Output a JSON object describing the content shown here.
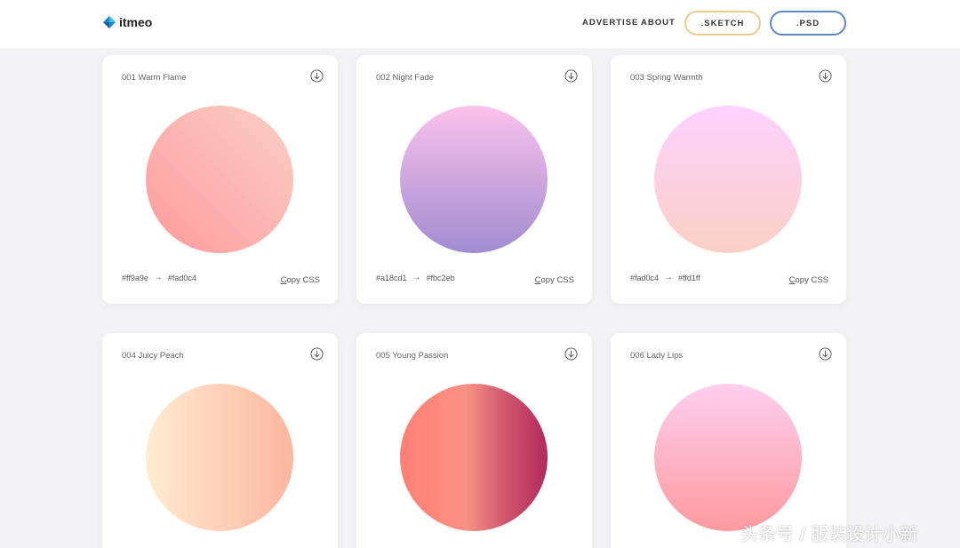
{
  "header": {
    "logo_text": "itmeo",
    "nav": {
      "advertise": "ADVERTISE",
      "about": "ABOUT"
    },
    "buttons": {
      "sketch": ".SKETCH",
      "psd": ".PSD"
    },
    "colors": {
      "sketch_border": "#e6cf8e",
      "psd_border": "#5f86c8"
    }
  },
  "gradients": [
    {
      "title": "001 Warm Flame",
      "from": "#ff9a9e",
      "to": "#fad0c4",
      "copy_prefix": "C",
      "copy_rest": "opy CSS"
    },
    {
      "title": "002 Night Fade",
      "from": "#a18cd1",
      "to": "#fbc2eb",
      "copy_prefix": "C",
      "copy_rest": "opy CSS"
    },
    {
      "title": "003 Spring Warmth",
      "from": "#fad0c4",
      "to": "#ffd1ff",
      "copy_prefix": "C",
      "copy_rest": "opy CSS"
    },
    {
      "title": "004 Juicy Peach"
    },
    {
      "title": "005 Young Passion"
    },
    {
      "title": "006 Lady Lips"
    }
  ],
  "icons": {
    "download": "download-icon",
    "arrow": "→"
  },
  "watermark": "头条号 / 服装设计小新"
}
